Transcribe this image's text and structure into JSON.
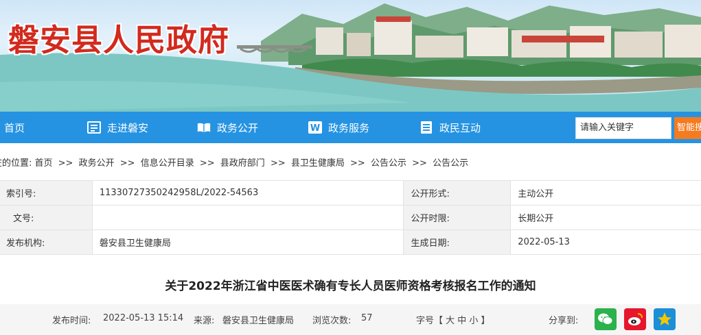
{
  "site": {
    "title": "磐安县人民政府"
  },
  "nav": {
    "items": [
      {
        "label": "首页"
      },
      {
        "label": "走进磐安"
      },
      {
        "label": "政务公开"
      },
      {
        "label": "政务服务"
      },
      {
        "label": "政民互动"
      }
    ],
    "search_value": "请输入关键字",
    "search_button": "智能搜"
  },
  "breadcrumb": {
    "items": [
      "在的位置: 首页",
      ">>",
      "政务公开",
      ">>",
      "信息公开目录",
      ">>",
      "县政府部门",
      ">>",
      "县卫生健康局",
      ">>",
      "公告公示",
      ">>",
      "公告公示"
    ]
  },
  "info": {
    "rows": [
      {
        "label1": "索引号:",
        "value1": "11330727350242958L/2022-54563",
        "label2": "公开形式:",
        "value2": "主动公开"
      },
      {
        "label1": "文号:",
        "value1": "",
        "label2": "公开时限:",
        "value2": "长期公开"
      },
      {
        "label1": "发布机构:",
        "value1": "磐安县卫生健康局",
        "label2": "生成日期:",
        "value2": "2022-05-13"
      }
    ]
  },
  "article": {
    "title": "关于2022年浙江省中医医术确有专长人员医师资格考核报名工作的通知"
  },
  "meta": {
    "publish_label": "发布时间:",
    "publish_time": "2022-05-13 15:14",
    "source_label": "来源:",
    "source": "磐安县卫生健康局",
    "views_label": "浏览次数:",
    "views": "57",
    "font_size": "字号【 大  中  小 】",
    "share_label": "分享到:"
  },
  "colors": {
    "nav": "#2593e2",
    "title_red": "#d22a1e",
    "search_btn": "#f47b20"
  },
  "icons": [
    "home",
    "book-icon",
    "open-book-icon",
    "w-icon",
    "list-icon",
    "wechat-icon",
    "weibo-icon",
    "qzone-icon"
  ]
}
